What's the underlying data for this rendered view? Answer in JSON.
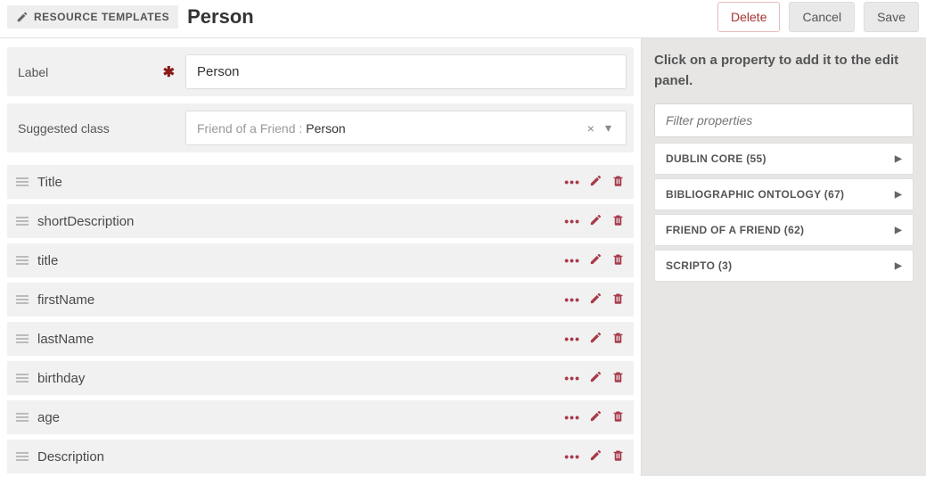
{
  "header": {
    "breadcrumb": "RESOURCE TEMPLATES",
    "title": "Person",
    "actions": {
      "delete": "Delete",
      "cancel": "Cancel",
      "save": "Save"
    }
  },
  "form": {
    "label_field": {
      "label": "Label",
      "value": "Person",
      "required": true
    },
    "class_field": {
      "label": "Suggested class",
      "prefix": "Friend of a Friend :",
      "value": "Person"
    }
  },
  "properties": [
    {
      "label": "Title"
    },
    {
      "label": "shortDescription"
    },
    {
      "label": "title"
    },
    {
      "label": "firstName"
    },
    {
      "label": "lastName"
    },
    {
      "label": "birthday"
    },
    {
      "label": "age"
    },
    {
      "label": "Description"
    }
  ],
  "sidebar": {
    "hint": "Click on a property to add it to the edit panel.",
    "filter_placeholder": "Filter properties",
    "vocabs": [
      {
        "label": "DUBLIN CORE (55)"
      },
      {
        "label": "BIBLIOGRAPHIC ONTOLOGY (67)"
      },
      {
        "label": "FRIEND OF A FRIEND (62)"
      },
      {
        "label": "SCRIPTO (3)"
      }
    ]
  }
}
